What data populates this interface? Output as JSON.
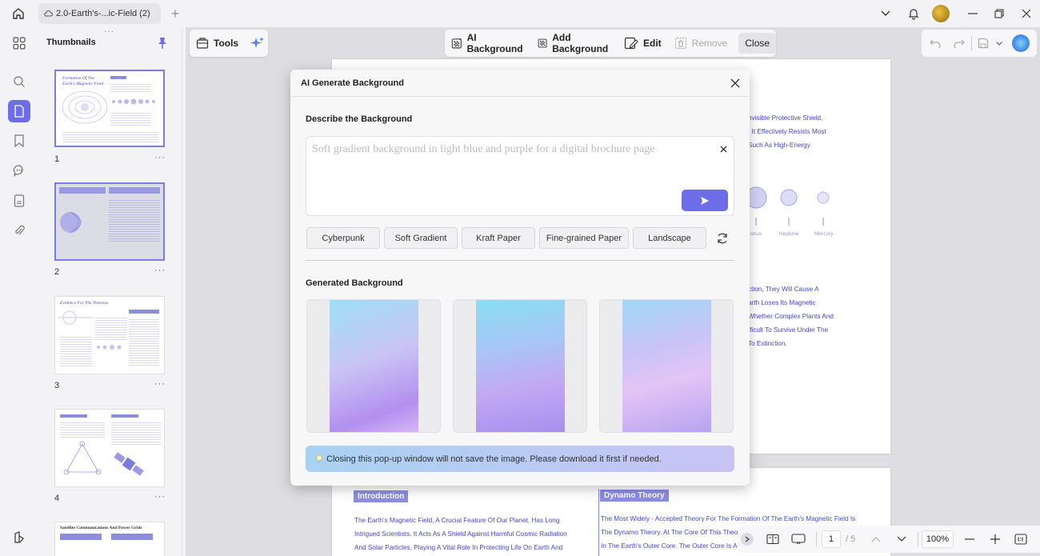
{
  "window": {
    "tab_title": "2.0-Earth's-...ic-Field (2)"
  },
  "thumbnails": {
    "title": "Thumbnails",
    "pages": [
      {
        "num": "1",
        "heading": "Formation Of The Earth's Magnetic Field"
      },
      {
        "num": "2",
        "heading": ""
      },
      {
        "num": "3",
        "heading": "Evidence For The Theories"
      },
      {
        "num": "4",
        "heading": ""
      },
      {
        "num": "",
        "heading": "Satellite Communications And Power Grids"
      }
    ],
    "more": "···"
  },
  "toolbar": {
    "tools_label": "Tools",
    "ai_background": "AI Background",
    "add_background": "Add Background",
    "edit": "Edit",
    "remove": "Remove",
    "close": "Close"
  },
  "document": {
    "right_lines_top": [
      "nvisible Protective Shield,",
      ". It Effectively Resists Most",
      " Such As High-Energy"
    ],
    "planets": [
      "ranus",
      "Neptune",
      "Mercury"
    ],
    "right_lines_mid": [
      "ction, They Will Cause A",
      "arth Loses Its Magnetic",
      "Whether Complex Plants And",
      "fficult To Survive Under The",
      "To Extinction."
    ],
    "intro_heading": "Introduction",
    "intro_lines": [
      "The Earth's Magnetic Field, A Crucial Feature Of Our Planet, Has Long",
      "Intrigued Scientists. It Acts As A Shield Against Harmful Cosmic Radiation",
      "And Solar Particles, Playing A Vital Role In Protecting Life On Earth And"
    ],
    "dynamo_heading": "Dynamo Theory",
    "dynamo_lines": [
      "The Most Widely - Accepted Theory For The Formation Of The Earth's Magnetic Field Is",
      "The Dynamo Theory. At The Core Of This Theor",
      "In The Earth's Outer Core. The Outer Core Is A F"
    ]
  },
  "modal": {
    "title": "AI Generate Background",
    "describe_label": "Describe the Background",
    "placeholder": "Soft gradient background in light blue and purple for a digital brochure page",
    "styles": [
      "Cyberpunk",
      "Soft Gradient",
      "Kraft Paper",
      "Fine-grained Paper",
      "Landscape"
    ],
    "generated_label": "Generated Background",
    "notice": "Closing this pop-up window will not save the image. Please download it first if needed.",
    "accent_color": "#6d6de8"
  },
  "statusbar": {
    "current_page": "1",
    "total_pages": "/ 5",
    "zoom": "100%"
  }
}
